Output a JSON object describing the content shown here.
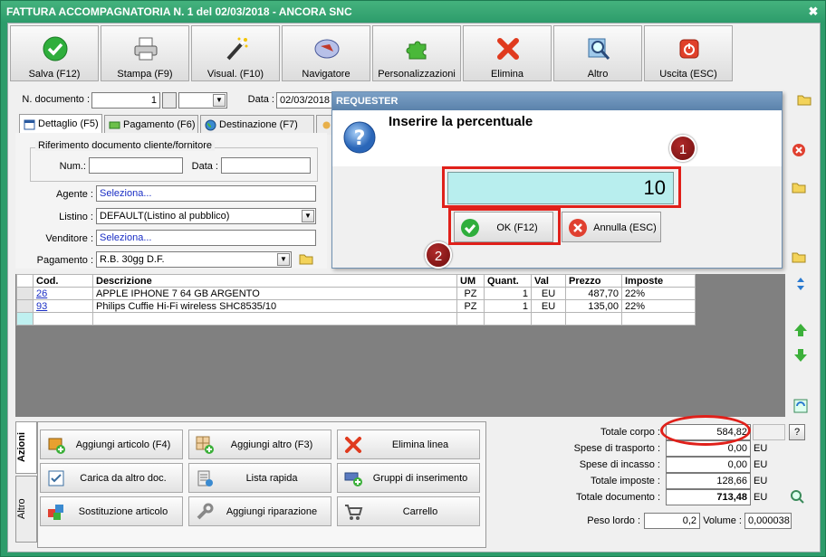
{
  "window": {
    "title": "FATTURA ACCOMPAGNATORIA N. 1 del 02/03/2018 - ANCORA SNC",
    "close": "✖"
  },
  "toolbar": [
    {
      "label": "Salva (F12)",
      "icon": "check-icon"
    },
    {
      "label": "Stampa (F9)",
      "icon": "printer-icon"
    },
    {
      "label": "Visual. (F10)",
      "icon": "magic-wand-icon"
    },
    {
      "label": "Navigatore",
      "icon": "compass-icon"
    },
    {
      "label": "Personalizzazioni",
      "icon": "puzzle-icon"
    },
    {
      "label": "Elimina",
      "icon": "delete-x-icon"
    },
    {
      "label": "Altro",
      "icon": "magnifier-icon"
    },
    {
      "label": "Uscita (ESC)",
      "icon": "power-icon"
    }
  ],
  "header": {
    "doc_label": "N. documento :",
    "doc_value": "1",
    "date_label": "Data :",
    "date_value": "02/03/2018"
  },
  "tabs": [
    {
      "label": "Dettaglio (F5)"
    },
    {
      "label": "Pagamento (F6)"
    },
    {
      "label": "Destinazione (F7)"
    }
  ],
  "form": {
    "ref_group": "Riferimento documento cliente/fornitore",
    "num_label": "Num.:",
    "data_label": "Data :",
    "agente_label": "Agente :",
    "agente_value": "Seleziona...",
    "listino_label": "Listino :",
    "listino_value": "DEFAULT(Listino al pubblico)",
    "venditore_label": "Venditore :",
    "venditore_value": "Seleziona...",
    "pagamento_label": "Pagamento :",
    "pagamento_value": "R.B. 30gg D.F."
  },
  "grid": {
    "headers": [
      "Cod.",
      "Descrizione",
      "UM",
      "Quant.",
      "Val",
      "Prezzo",
      "Imposte"
    ],
    "rows": [
      {
        "cod": "26",
        "desc": "APPLE IPHONE 7 64 GB ARGENTO",
        "um": "PZ",
        "qty": "1",
        "val": "EU",
        "price": "487,70",
        "tax": "22%"
      },
      {
        "cod": "93",
        "desc": "Philips Cuffie Hi-Fi wireless SHC8535/10",
        "um": "PZ",
        "qty": "1",
        "val": "EU",
        "price": "135,00",
        "tax": "22%"
      }
    ]
  },
  "vtabs": {
    "azioni": "Azioni",
    "altro": "Altro"
  },
  "actions": [
    {
      "label": "Aggiungi articolo (F4)",
      "icon": "add-box-icon"
    },
    {
      "label": "Aggiungi altro (F3)",
      "icon": "add-grid-icon"
    },
    {
      "label": "Elimina linea",
      "icon": "delete-x-icon"
    },
    {
      "label": "Carica da altro doc.",
      "icon": "load-doc-icon"
    },
    {
      "label": "Lista rapida",
      "icon": "quick-list-icon"
    },
    {
      "label": "Gruppi di inserimento",
      "icon": "group-insert-icon"
    },
    {
      "label": "Sostituzione articolo",
      "icon": "replace-icon"
    },
    {
      "label": "Aggiungi riparazione",
      "icon": "wrench-icon"
    },
    {
      "label": "Carrello",
      "icon": "cart-icon"
    }
  ],
  "totals": {
    "corpo_label": "Totale corpo :",
    "corpo": "584,82",
    "trasporto_label": "Spese di trasporto :",
    "trasporto": "0,00",
    "incasso_label": "Spese di incasso :",
    "incasso": "0,00",
    "imposte_label": "Totale imposte :",
    "imposte": "128,66",
    "documento_label": "Totale documento :",
    "documento": "713,48",
    "currency": "EU",
    "help": "?",
    "peso_label": "Peso lordo :",
    "peso": "0,2",
    "volume_label": "Volume :",
    "volume": "0,000038"
  },
  "dialog": {
    "title": "REQUESTER",
    "heading": "Inserire la percentuale",
    "value": "10",
    "ok": "OK (F12)",
    "cancel": "Annulla (ESC)"
  },
  "annotations": {
    "badge1": "1",
    "badge2": "2"
  },
  "colors": {
    "frame": "#2d9c6b",
    "highlight": "#e0201a",
    "input_cyan": "#b8eeee"
  }
}
